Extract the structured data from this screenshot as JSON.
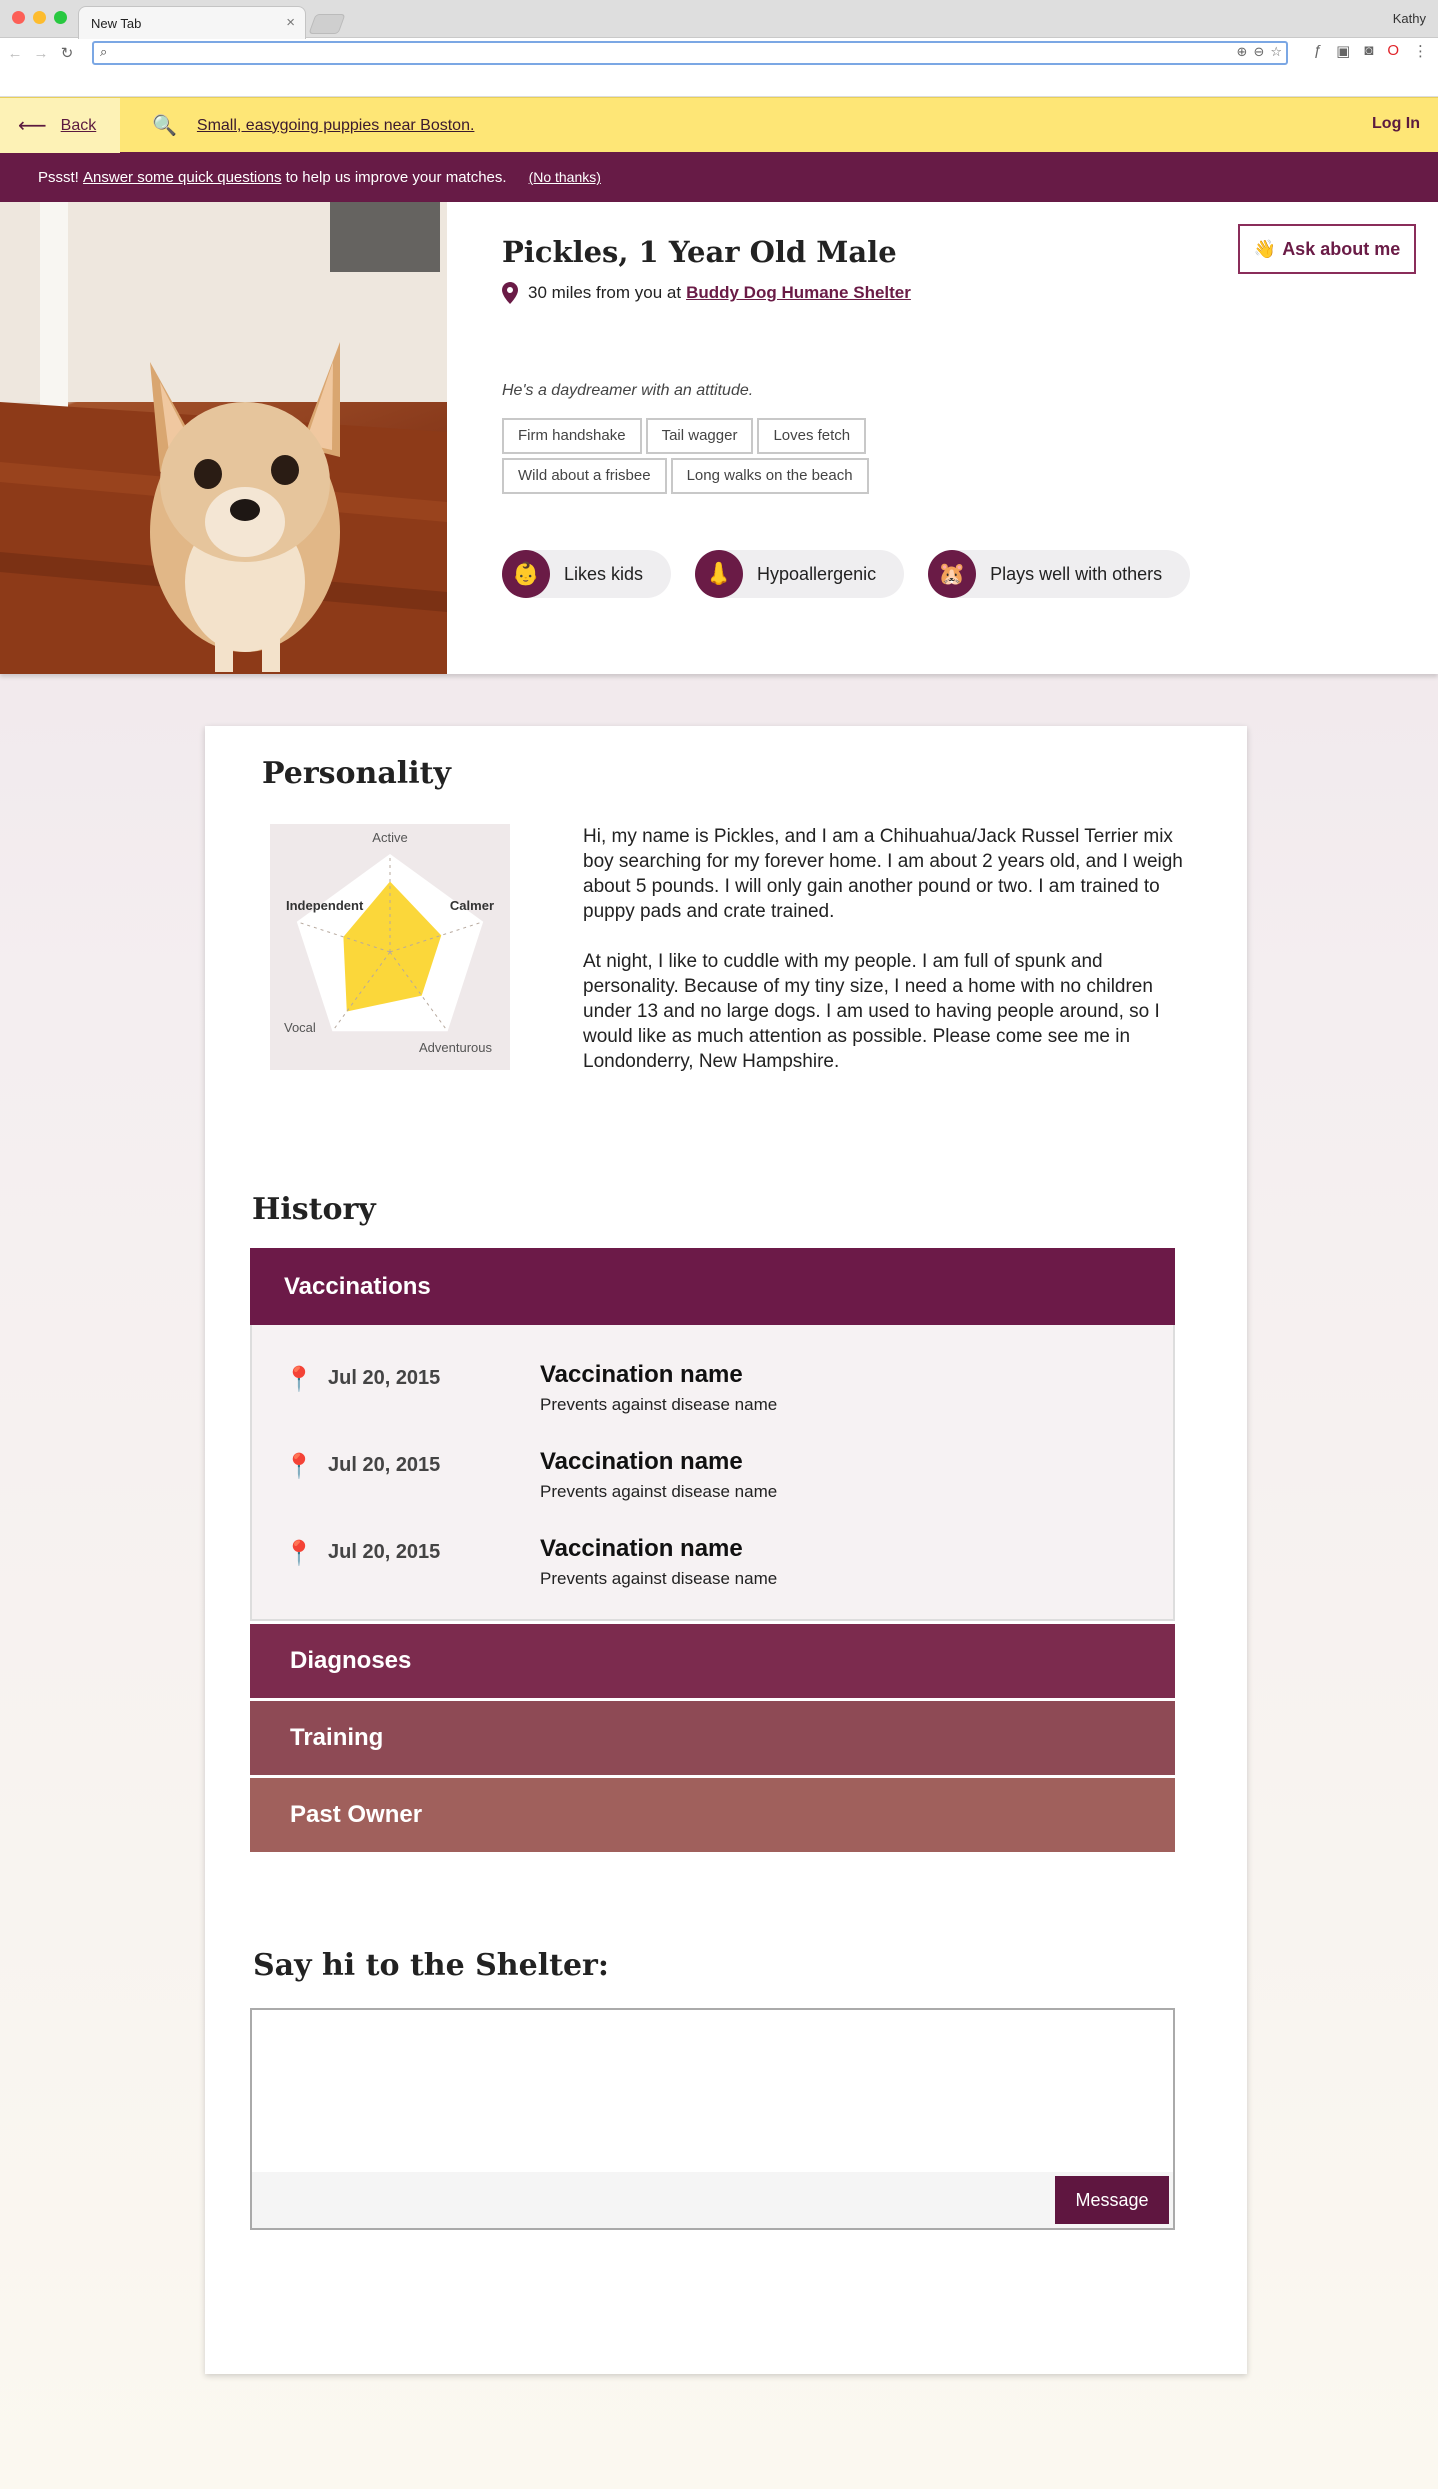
{
  "browser": {
    "tab_title": "New Tab",
    "tab_close": "×",
    "user_name": "Kathy",
    "search_icon_glyph": "⌕"
  },
  "topbar": {
    "back_label": "Back",
    "search_query": "Small, easygoing puppies near Boston.",
    "login_label": "Log In"
  },
  "promo": {
    "lead": "Pssst!",
    "link": "Answer some quick questions",
    "rest": "to help us improve your matches.",
    "dismiss": "(No thanks)"
  },
  "pet": {
    "name": "Pickles, 1 Year Old Male",
    "distance": "30 miles from you at",
    "shelter": "Buddy Dog Humane Shelter",
    "ask_label": "Ask about me",
    "tagline": "He's a daydreamer with an attitude.",
    "tags": [
      "Firm handshake",
      "Tail wagger",
      "Loves fetch",
      "Wild about a frisbee",
      "Long walks on the beach"
    ],
    "traits": [
      {
        "label": "Likes kids",
        "icon": "baby-face-icon",
        "glyph": "👶"
      },
      {
        "label": "Hypoallergenic",
        "icon": "nose-icon",
        "glyph": "👃"
      },
      {
        "label": "Plays well with others",
        "icon": "hamster-icon",
        "glyph": "🐹"
      }
    ]
  },
  "personality": {
    "title": "Personality",
    "radar_axes": [
      "Active",
      "Calmer",
      "Adventurous",
      "Vocal",
      "Independent"
    ],
    "radar_values": [
      0.72,
      0.55,
      0.55,
      0.75,
      0.5
    ],
    "bio": [
      "Hi, my name is Pickles, and I am a Chihuahua/Jack Russel Terrier mix boy searching for my forever home. I am about 2 years old, and I weigh about 5 pounds. I will only gain another pound or two. I am trained to puppy pads and crate trained.",
      "At night, I like to cuddle with my people. I am full of spunk and personality. Because of my tiny size, I need a home with no children under 13 and no large dogs. I am used to having people around, so I would like as much attention as possible. Please come see me in Londonderry, New Hampshire."
    ]
  },
  "history": {
    "title": "History",
    "vaccinations": {
      "label": "Vaccinations",
      "items": [
        {
          "date": "Jul 20, 2015",
          "name": "Vaccination name",
          "desc": "Prevents against disease name"
        },
        {
          "date": "Jul 20, 2015",
          "name": "Vaccination name",
          "desc": "Prevents against disease name"
        },
        {
          "date": "Jul 20, 2015",
          "name": "Vaccination name",
          "desc": "Prevents against disease name"
        }
      ]
    },
    "sections": [
      {
        "label": "Diagnoses",
        "color": "#7c2b4e"
      },
      {
        "label": "Training",
        "color": "#8e4a55"
      },
      {
        "label": "Past Owner",
        "color": "#a0605c"
      }
    ]
  },
  "message": {
    "title": "Say hi to the Shelter:",
    "placeholder": "",
    "button": "Message"
  },
  "colors": {
    "brand": "#6a1b46",
    "topbar": "#fee676",
    "radar_fill": "#fbd73a"
  }
}
